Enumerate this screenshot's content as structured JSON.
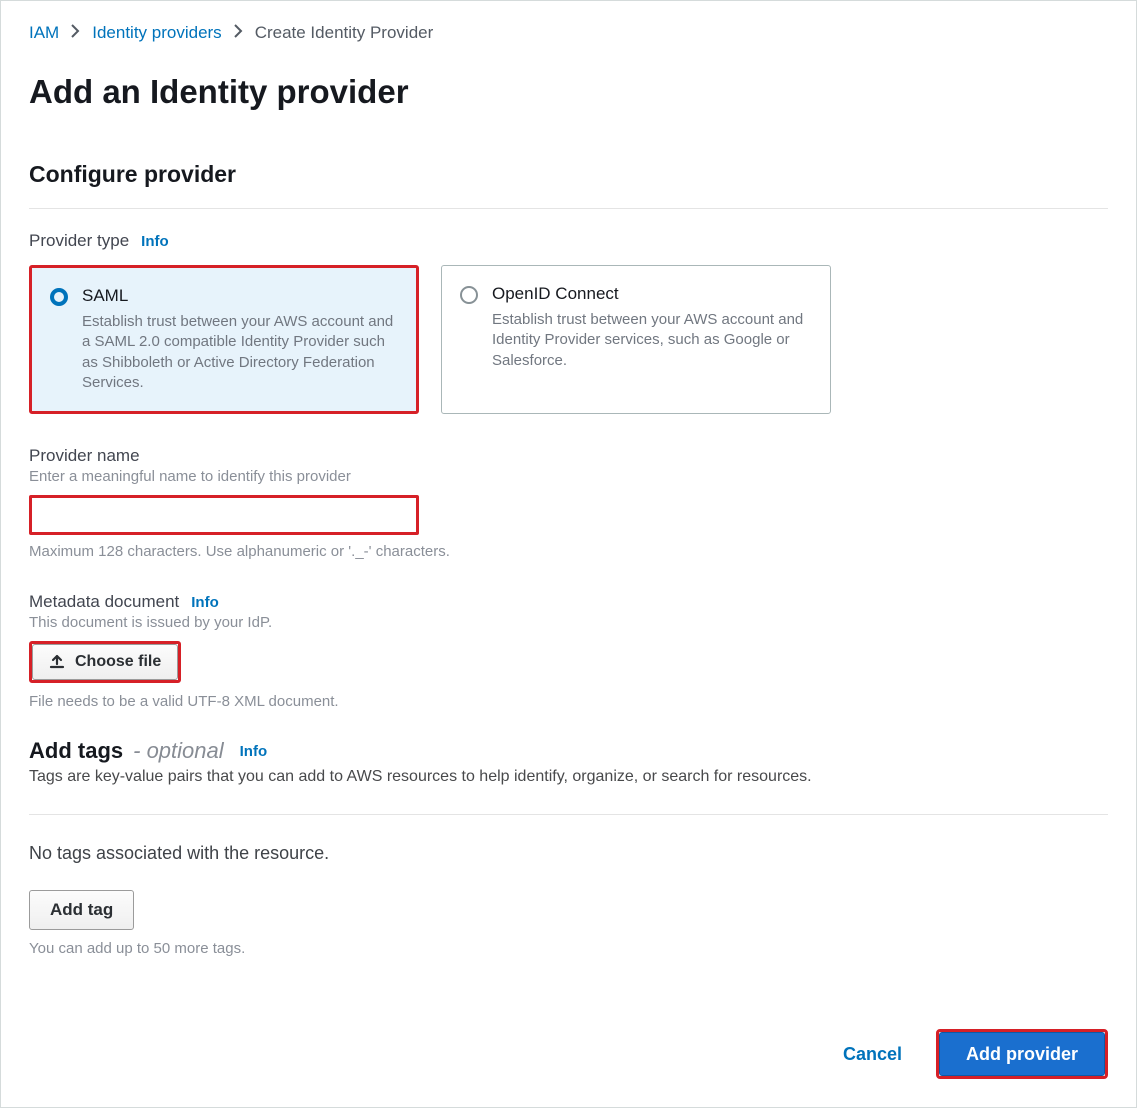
{
  "breadcrumb": {
    "iam": "IAM",
    "idp": "Identity providers",
    "current": "Create Identity Provider"
  },
  "page_title": "Add an Identity provider",
  "configure": {
    "heading": "Configure provider",
    "provider_type_label": "Provider type",
    "info": "Info",
    "options": {
      "saml": {
        "title": "SAML",
        "desc": "Establish trust between your AWS account and a SAML 2.0 compatible Identity Provider such as Shibboleth or Active Directory Federation Services.",
        "selected": true
      },
      "oidc": {
        "title": "OpenID Connect",
        "desc": "Establish trust between your AWS account and Identity Provider services, such as Google or Salesforce.",
        "selected": false
      }
    },
    "provider_name": {
      "label": "Provider name",
      "hint": "Enter a meaningful name to identify this provider",
      "value": "",
      "constraint": "Maximum 128 characters. Use alphanumeric or '._-' characters."
    },
    "metadata": {
      "label": "Metadata document",
      "hint": "This document is issued by your IdP.",
      "button": "Choose file",
      "constraint": "File needs to be a valid UTF-8 XML document."
    }
  },
  "tags": {
    "heading": "Add tags",
    "optional": "- optional",
    "info": "Info",
    "desc": "Tags are key-value pairs that you can add to AWS resources to help identify, organize, or search for resources.",
    "empty": "No tags associated with the resource.",
    "add_button": "Add tag",
    "limit": "You can add up to 50 more tags."
  },
  "footer": {
    "cancel": "Cancel",
    "submit": "Add provider"
  }
}
